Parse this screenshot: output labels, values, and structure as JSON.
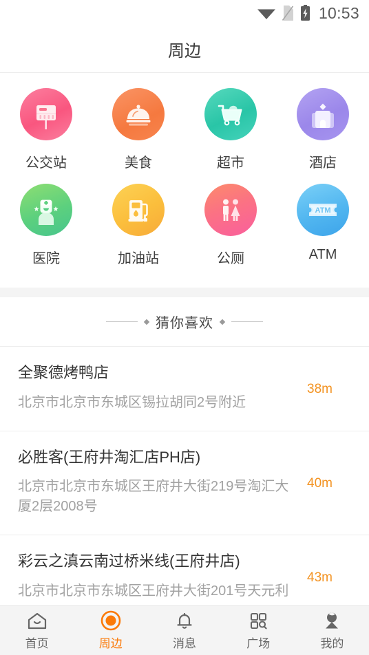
{
  "statusbar": {
    "time": "10:53",
    "icons": [
      "wifi-icon",
      "sim-card-off-icon",
      "battery-charging-icon"
    ]
  },
  "header": {
    "title": "周边"
  },
  "categories": [
    {
      "label": "公交站",
      "icon": "bus-stop-icon",
      "color": "#f9567f"
    },
    {
      "label": "美食",
      "icon": "food-cloche-icon",
      "color": "#f5793f"
    },
    {
      "label": "超市",
      "icon": "shopping-cart-icon",
      "color": "#29c5a7"
    },
    {
      "label": "酒店",
      "icon": "hotel-icon",
      "color": "#9b87ea"
    },
    {
      "label": "医院",
      "icon": "hospital-nurse-icon",
      "color": "#5cd07e"
    },
    {
      "label": "加油站",
      "icon": "gas-pump-icon",
      "color": "#fbbe3c"
    },
    {
      "label": "公厕",
      "icon": "restroom-icon",
      "color": "#fb7283"
    },
    {
      "label": "ATM",
      "icon": "atm-card-icon",
      "color": "#51b6f0"
    }
  ],
  "section": {
    "title": "猜你喜欢"
  },
  "pois": [
    {
      "name": "全聚德烤鸭店",
      "address": "北京市北京市东城区锡拉胡同2号附近",
      "distance": "38m"
    },
    {
      "name": "必胜客(王府井淘汇店PH店)",
      "address": "北京市北京市东城区王府井大街219号淘汇大厦2层2008号",
      "distance": "40m"
    },
    {
      "name": "彩云之滇云南过桥米线(王府井店)",
      "address": "北京市北京市东城区王府井大街201号天元利",
      "distance": "43m"
    }
  ],
  "tabbar": {
    "active_index": 1,
    "accent": "#fb7a09",
    "items": [
      {
        "label": "首页",
        "icon": "home-icon"
      },
      {
        "label": "周边",
        "icon": "nearby-target-icon"
      },
      {
        "label": "消息",
        "icon": "bell-icon"
      },
      {
        "label": "广场",
        "icon": "grid-search-icon"
      },
      {
        "label": "我的",
        "icon": "user-icon"
      }
    ]
  }
}
